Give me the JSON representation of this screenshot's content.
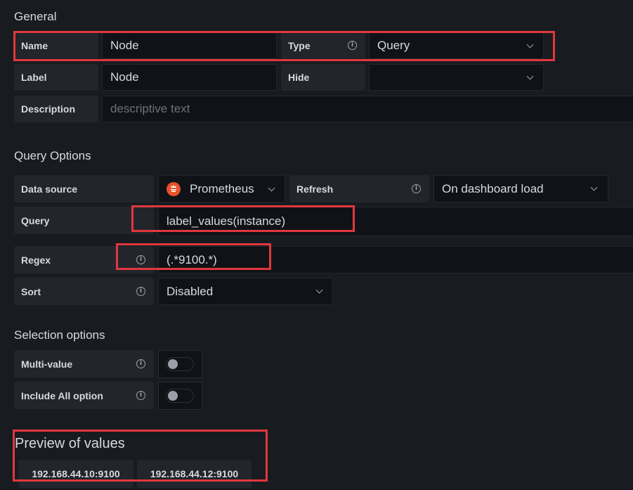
{
  "general": {
    "heading": "General",
    "name_label": "Name",
    "name_value": "Node",
    "type_label": "Type",
    "type_value": "Query",
    "label_label": "Label",
    "label_value": "Node",
    "hide_label": "Hide",
    "hide_value": "",
    "description_label": "Description",
    "description_placeholder": "descriptive text"
  },
  "query_options": {
    "heading": "Query Options",
    "datasource_label": "Data source",
    "datasource_value": "Prometheus",
    "refresh_label": "Refresh",
    "refresh_value": "On dashboard load",
    "query_label": "Query",
    "query_value": "label_values(instance)",
    "regex_label": "Regex",
    "regex_value": "(.*9100.*)",
    "sort_label": "Sort",
    "sort_value": "Disabled"
  },
  "selection_options": {
    "heading": "Selection options",
    "multi_value_label": "Multi-value",
    "multi_value_enabled": false,
    "include_all_label": "Include All option",
    "include_all_enabled": false
  },
  "preview": {
    "heading": "Preview of values",
    "values": [
      "192.168.44.10:9100",
      "192.168.44.12:9100"
    ]
  },
  "icons": {
    "info": "i"
  },
  "colors": {
    "highlight": "#e0383e",
    "prometheus": "#e6522c"
  }
}
